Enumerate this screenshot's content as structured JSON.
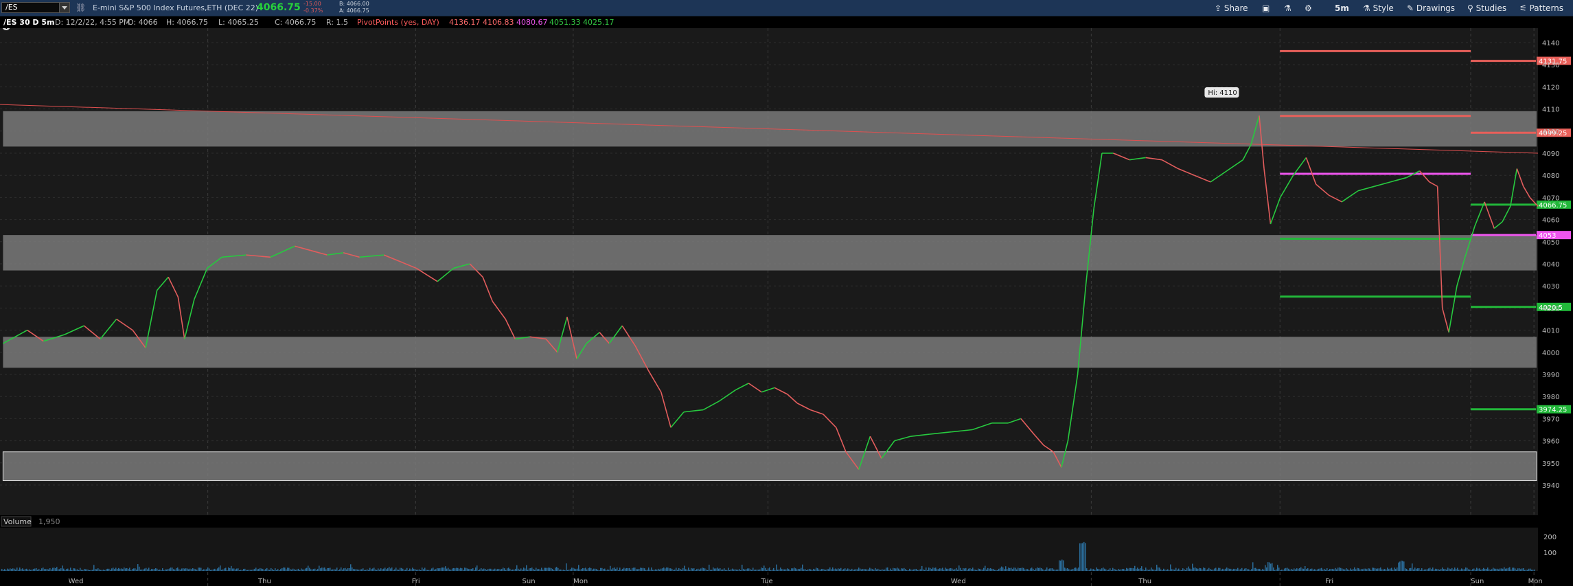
{
  "header": {
    "symbol": "/ES",
    "description": "E-mini S&P 500 Index Futures,ETH (DEC 22)",
    "last": "4066.75",
    "change": "-15.00",
    "change_pct": "-0.37%",
    "bid": "B: 4066.00",
    "ask": "A: 4066.75",
    "tools": {
      "share": "Share",
      "interval": "5m",
      "style": "Style",
      "drawings": "Drawings",
      "studies": "Studies",
      "patterns": "Patterns"
    }
  },
  "info": {
    "chart_id": "/ES 30 D 5m",
    "date": "D: 12/2/22, 4:55 PM",
    "open": "O: 4066",
    "high": "H: 4066.75",
    "low": "L: 4065.25",
    "close": "C: 4066.75",
    "range": "R: 1.5",
    "pivot_label": "PivotPoints (yes, DAY)",
    "pivots": [
      "4136.17",
      "4106.83",
      "4080.67",
      "4051.33",
      "4025.17"
    ]
  },
  "chart_data": {
    "type": "line",
    "y_ticks": [
      "4140",
      "4130",
      "4120",
      "4110",
      "4100",
      "4090",
      "4080",
      "4070",
      "4060",
      "4050",
      "4040",
      "4030",
      "4020",
      "4010",
      "4000",
      "3990",
      "3980",
      "3970",
      "3960",
      "3950",
      "3940"
    ],
    "x_labels": [
      "Wed",
      "Thu",
      "Fri",
      "Sun",
      "Mon",
      "Tue",
      "Wed",
      "Thu",
      "Fri",
      "Sun",
      "Mon"
    ],
    "price_flags": [
      {
        "value": 4131.75,
        "label": "4131.75",
        "color": "#e8605a"
      },
      {
        "value": 4099.25,
        "label": "4099.25",
        "color": "#e8605a"
      },
      {
        "value": 4066.75,
        "label": "4066.75",
        "color": "#22b83a"
      },
      {
        "value": 4053,
        "label": "4053",
        "color": "#ee55ee"
      },
      {
        "value": 4020.5,
        "label": "4020.5",
        "color": "#22b83a"
      },
      {
        "value": 3974.25,
        "label": "3974.25",
        "color": "#22b83a"
      }
    ],
    "zones": [
      [
        4093,
        4109
      ],
      [
        4037,
        4053
      ],
      [
        3993,
        4007
      ],
      [
        3942,
        3955
      ]
    ],
    "high_label": "Hi: 4110",
    "volume_label": "Volume",
    "volume_value": "1,950",
    "volume_ticks": [
      "200",
      "100"
    ],
    "price_path": [
      [
        0,
        4004
      ],
      [
        15,
        4010
      ],
      [
        25,
        4005
      ],
      [
        38,
        4008
      ],
      [
        50,
        4012
      ],
      [
        60,
        4006
      ],
      [
        70,
        4015
      ],
      [
        80,
        4010
      ],
      [
        88,
        4002
      ],
      [
        95,
        4028
      ],
      [
        102,
        4034
      ],
      [
        108,
        4025
      ],
      [
        112,
        4006
      ],
      [
        118,
        4024
      ],
      [
        126,
        4038
      ],
      [
        135,
        4043
      ],
      [
        150,
        4044
      ],
      [
        165,
        4043
      ],
      [
        180,
        4048
      ],
      [
        190,
        4046
      ],
      [
        200,
        4044
      ],
      [
        210,
        4045
      ],
      [
        220,
        4043
      ],
      [
        235,
        4044
      ],
      [
        245,
        4041
      ],
      [
        255,
        4038
      ],
      [
        268,
        4032
      ],
      [
        278,
        4038
      ],
      [
        288,
        4040
      ],
      [
        296,
        4034
      ],
      [
        302,
        4023
      ],
      [
        310,
        4015
      ],
      [
        316,
        4006
      ],
      [
        325,
        4007
      ],
      [
        335,
        4006
      ],
      [
        342,
        4000
      ],
      [
        348,
        4016
      ],
      [
        354,
        3997
      ],
      [
        360,
        4004
      ],
      [
        368,
        4009
      ],
      [
        374,
        4004
      ],
      [
        382,
        4012
      ],
      [
        390,
        4003
      ],
      [
        398,
        3992
      ],
      [
        406,
        3982
      ],
      [
        412,
        3966
      ],
      [
        420,
        3973
      ],
      [
        432,
        3974
      ],
      [
        442,
        3978
      ],
      [
        452,
        3983
      ],
      [
        460,
        3986
      ],
      [
        468,
        3982
      ],
      [
        476,
        3984
      ],
      [
        484,
        3981
      ],
      [
        490,
        3977
      ],
      [
        498,
        3974
      ],
      [
        506,
        3972
      ],
      [
        514,
        3966
      ],
      [
        520,
        3955
      ],
      [
        528,
        3947
      ],
      [
        535,
        3962
      ],
      [
        542,
        3952
      ],
      [
        550,
        3960
      ],
      [
        560,
        3962
      ],
      [
        572,
        3963
      ],
      [
        585,
        3964
      ],
      [
        598,
        3965
      ],
      [
        610,
        3968
      ],
      [
        620,
        3968
      ],
      [
        628,
        3970
      ],
      [
        636,
        3963
      ],
      [
        642,
        3958
      ],
      [
        648,
        3955
      ],
      [
        653,
        3948
      ],
      [
        657,
        3960
      ],
      [
        663,
        3990
      ],
      [
        668,
        4030
      ],
      [
        673,
        4065
      ],
      [
        678,
        4090
      ],
      [
        685,
        4090
      ],
      [
        695,
        4087
      ],
      [
        705,
        4088
      ],
      [
        715,
        4087
      ],
      [
        725,
        4083
      ],
      [
        735,
        4080
      ],
      [
        745,
        4077
      ],
      [
        755,
        4082
      ],
      [
        765,
        4087
      ],
      [
        770,
        4094
      ],
      [
        775,
        4107
      ],
      [
        778,
        4083
      ],
      [
        782,
        4058
      ],
      [
        788,
        4070
      ],
      [
        796,
        4080
      ],
      [
        804,
        4088
      ],
      [
        810,
        4076
      ],
      [
        818,
        4071
      ],
      [
        826,
        4068
      ],
      [
        836,
        4073
      ],
      [
        846,
        4075
      ],
      [
        856,
        4077
      ],
      [
        866,
        4079
      ],
      [
        874,
        4082
      ],
      [
        880,
        4077
      ],
      [
        885,
        4075
      ],
      [
        888,
        4020
      ],
      [
        892,
        4009
      ],
      [
        897,
        4030
      ],
      [
        902,
        4043
      ],
      [
        908,
        4057
      ],
      [
        914,
        4068
      ],
      [
        920,
        4056
      ],
      [
        925,
        4059
      ],
      [
        930,
        4066
      ],
      [
        934,
        4083
      ],
      [
        938,
        4075
      ],
      [
        942,
        4070
      ],
      [
        947,
        4066
      ]
    ],
    "series": [
      {
        "name": "R2",
        "value": 4136.17,
        "color": "#e8605a"
      },
      {
        "name": "R1",
        "value": 4106.83,
        "color": "#e8605a"
      },
      {
        "name": "PP",
        "value": 4080.67,
        "color": "#ee55ee"
      },
      {
        "name": "S1",
        "value": 4051.33,
        "color": "#22b83a"
      },
      {
        "name": "S2",
        "value": 4025.17,
        "color": "#22b83a"
      }
    ],
    "trendline": {
      "from": 4112,
      "to": 4090,
      "color": "#e05050"
    }
  },
  "colors": {
    "up": "#27c93f",
    "down": "#e35d5d",
    "zone": "#7a7a7a",
    "resistance": "#e8605a",
    "pivot": "#ee55ee",
    "support": "#22b83a",
    "volume": "#2a6c9a"
  }
}
